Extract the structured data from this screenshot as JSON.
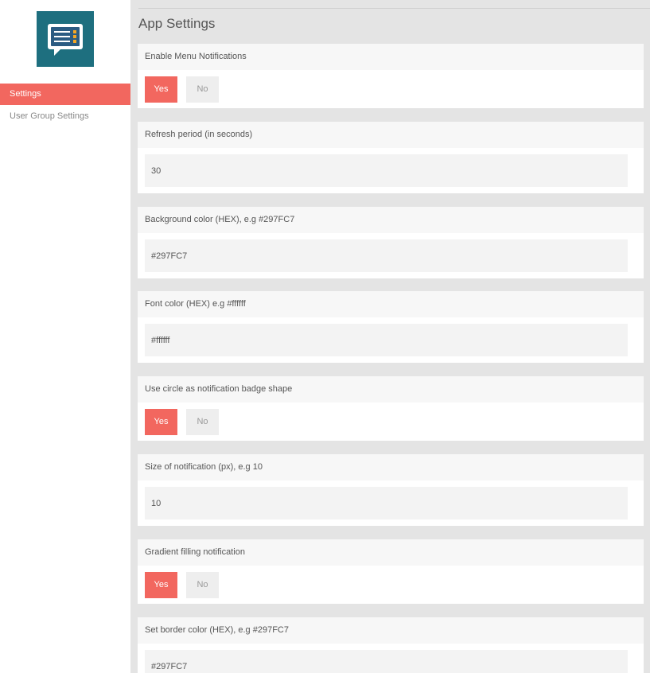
{
  "sidebar": {
    "logo_icon": "notification-list-icon",
    "items": [
      {
        "label": "Settings",
        "active": true
      },
      {
        "label": "User Group Settings",
        "active": false
      }
    ]
  },
  "main": {
    "title": "App Settings",
    "settings": [
      {
        "label": "Enable Menu Notifications",
        "type": "toggle",
        "yes": "Yes",
        "no": "No",
        "selected": "Yes"
      },
      {
        "label": "Refresh period (in seconds)",
        "type": "input",
        "value": "30"
      },
      {
        "label": "Background color (HEX), e.g #297FC7",
        "type": "input",
        "value": "#297FC7"
      },
      {
        "label": "Font color (HEX) e.g #ffffff",
        "type": "input",
        "value": "#ffffff"
      },
      {
        "label": "Use circle as notification badge shape",
        "type": "toggle",
        "yes": "Yes",
        "no": "No",
        "selected": "Yes"
      },
      {
        "label": "Size of notification (px), e.g 10",
        "type": "input",
        "value": "10"
      },
      {
        "label": "Gradient filling notification",
        "type": "toggle",
        "yes": "Yes",
        "no": "No",
        "selected": "Yes"
      },
      {
        "label": "Set border color (HEX), e.g #297FC7",
        "type": "input",
        "value": "#297FC7"
      }
    ]
  },
  "colors": {
    "accent": "#f2675f",
    "logo_bg": "#1e6f7f",
    "page_bg": "#e4e4e4"
  }
}
